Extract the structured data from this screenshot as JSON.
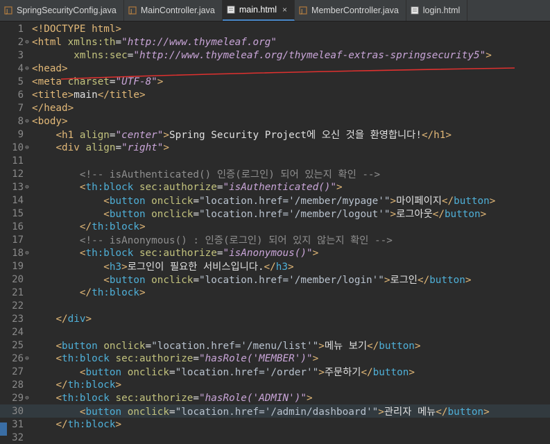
{
  "tabs": [
    {
      "label": "SpringSecurityConfig.java",
      "icon": "java-file-icon",
      "active": false
    },
    {
      "label": "MainController.java",
      "icon": "java-file-icon",
      "active": false
    },
    {
      "label": "main.html",
      "icon": "html-file-icon",
      "active": true,
      "close": "×"
    },
    {
      "label": "MemberController.java",
      "icon": "java-file-icon",
      "active": false
    },
    {
      "label": "login.html",
      "icon": "html-file-icon",
      "active": false
    }
  ],
  "editor": {
    "current_line": 30,
    "annotation_color": "#e0312f",
    "lines": [
      {
        "n": "1",
        "fold": "",
        "segs": [
          [
            "tg",
            "<!DOCTYPE "
          ],
          [
            "tnb",
            "html"
          ],
          [
            "tg",
            ">"
          ]
        ]
      },
      {
        "n": "2",
        "fold": "⊖",
        "segs": [
          [
            "tg",
            "<"
          ],
          [
            "tnb",
            "html "
          ],
          [
            "at",
            "xmlns:th"
          ],
          [
            "tx",
            "="
          ],
          [
            "av",
            "\"http://www.thymeleaf.org\""
          ]
        ]
      },
      {
        "n": "3",
        "fold": "",
        "segs": [
          [
            "tx",
            "       "
          ],
          [
            "at",
            "xmlns:sec"
          ],
          [
            "tx",
            "="
          ],
          [
            "av",
            "\"http://www.thymeleaf.org/thymeleaf-extras-springsecurity5\""
          ],
          [
            "tg",
            ">"
          ]
        ]
      },
      {
        "n": "4",
        "fold": "⊖",
        "segs": [
          [
            "tg",
            "<"
          ],
          [
            "tnb",
            "head"
          ],
          [
            "tg",
            ">"
          ]
        ]
      },
      {
        "n": "5",
        "fold": "",
        "segs": [
          [
            "tg",
            "<"
          ],
          [
            "tnb",
            "meta "
          ],
          [
            "at",
            "charset"
          ],
          [
            "tx",
            "="
          ],
          [
            "av",
            "\"UTF-8\""
          ],
          [
            "tg",
            ">"
          ]
        ]
      },
      {
        "n": "6",
        "fold": "",
        "segs": [
          [
            "tg",
            "<"
          ],
          [
            "tnb",
            "title"
          ],
          [
            "tg",
            ">"
          ],
          [
            "tx",
            "main"
          ],
          [
            "tg",
            "</"
          ],
          [
            "tnb",
            "title"
          ],
          [
            "tg",
            ">"
          ]
        ]
      },
      {
        "n": "7",
        "fold": "",
        "segs": [
          [
            "tg",
            "</"
          ],
          [
            "tnb",
            "head"
          ],
          [
            "tg",
            ">"
          ]
        ]
      },
      {
        "n": "8",
        "fold": "⊖",
        "segs": [
          [
            "tg",
            "<"
          ],
          [
            "tnb",
            "body"
          ],
          [
            "tg",
            ">"
          ]
        ]
      },
      {
        "n": "9",
        "fold": "",
        "segs": [
          [
            "tx",
            "    "
          ],
          [
            "tg",
            "<"
          ],
          [
            "tnb",
            "h1 "
          ],
          [
            "at",
            "align"
          ],
          [
            "tx",
            "="
          ],
          [
            "av",
            "\"center\""
          ],
          [
            "tg",
            ">"
          ],
          [
            "tx",
            "Spring Security Project에 오신 것을 환영합니다!"
          ],
          [
            "tg",
            "</"
          ],
          [
            "tnb",
            "h1"
          ],
          [
            "tg",
            ">"
          ]
        ]
      },
      {
        "n": "10",
        "fold": "⊖",
        "segs": [
          [
            "tx",
            "    "
          ],
          [
            "tg",
            "<"
          ],
          [
            "tnb",
            "div "
          ],
          [
            "at",
            "align"
          ],
          [
            "tx",
            "="
          ],
          [
            "av",
            "\"right\""
          ],
          [
            "tg",
            ">"
          ]
        ]
      },
      {
        "n": "11",
        "fold": "",
        "segs": []
      },
      {
        "n": "12",
        "fold": "",
        "segs": [
          [
            "tx",
            "        "
          ],
          [
            "cm",
            "<!-- isAuthenticated() 인증(로그인) 되어 있는지 확인 -->"
          ]
        ]
      },
      {
        "n": "13",
        "fold": "⊖",
        "segs": [
          [
            "tx",
            "        "
          ],
          [
            "tg",
            "<"
          ],
          [
            "tn",
            "th:block "
          ],
          [
            "at",
            "sec:authorize"
          ],
          [
            "tx",
            "="
          ],
          [
            "av",
            "\"isAuthenticated()\""
          ],
          [
            "tg",
            ">"
          ]
        ]
      },
      {
        "n": "14",
        "fold": "",
        "segs": [
          [
            "tx",
            "            "
          ],
          [
            "tg",
            "<"
          ],
          [
            "tn",
            "button "
          ],
          [
            "at",
            "onclick"
          ],
          [
            "tx",
            "="
          ],
          [
            "avs",
            "\"location.href='/member/mypage'\""
          ],
          [
            "tg",
            ">"
          ],
          [
            "tx",
            "마이페이지"
          ],
          [
            "tg",
            "</"
          ],
          [
            "tn",
            "button"
          ],
          [
            "tg",
            ">"
          ]
        ]
      },
      {
        "n": "15",
        "fold": "",
        "segs": [
          [
            "tx",
            "            "
          ],
          [
            "tg",
            "<"
          ],
          [
            "tn",
            "button "
          ],
          [
            "at",
            "onclick"
          ],
          [
            "tx",
            "="
          ],
          [
            "avs",
            "\"location.href='/member/logout'\""
          ],
          [
            "tg",
            ">"
          ],
          [
            "tx",
            "로그아웃"
          ],
          [
            "tg",
            "</"
          ],
          [
            "tn",
            "button"
          ],
          [
            "tg",
            ">"
          ]
        ]
      },
      {
        "n": "16",
        "fold": "",
        "segs": [
          [
            "tx",
            "        "
          ],
          [
            "tg",
            "</"
          ],
          [
            "tn",
            "th:block"
          ],
          [
            "tg",
            ">"
          ]
        ]
      },
      {
        "n": "17",
        "fold": "",
        "segs": [
          [
            "tx",
            "        "
          ],
          [
            "cm",
            "<!-- isAnonymous() : 인증(로그인) 되어 있지 않는지 확인 -->"
          ]
        ]
      },
      {
        "n": "18",
        "fold": "⊖",
        "segs": [
          [
            "tx",
            "        "
          ],
          [
            "tg",
            "<"
          ],
          [
            "tn",
            "th:block "
          ],
          [
            "at",
            "sec:authorize"
          ],
          [
            "tx",
            "="
          ],
          [
            "av",
            "\"isAnonymous()\""
          ],
          [
            "tg",
            ">"
          ]
        ]
      },
      {
        "n": "19",
        "fold": "",
        "segs": [
          [
            "tx",
            "            "
          ],
          [
            "tg",
            "<"
          ],
          [
            "tn",
            "h3"
          ],
          [
            "tg",
            ">"
          ],
          [
            "tx",
            "로그인이 필요한 서비스입니다."
          ],
          [
            "tg",
            "</"
          ],
          [
            "tn",
            "h3"
          ],
          [
            "tg",
            ">"
          ]
        ]
      },
      {
        "n": "20",
        "fold": "",
        "segs": [
          [
            "tx",
            "            "
          ],
          [
            "tg",
            "<"
          ],
          [
            "tn",
            "button "
          ],
          [
            "at",
            "onclick"
          ],
          [
            "tx",
            "="
          ],
          [
            "avs",
            "\"location.href='/member/login'\""
          ],
          [
            "tg",
            ">"
          ],
          [
            "tx",
            "로그인"
          ],
          [
            "tg",
            "</"
          ],
          [
            "tn",
            "button"
          ],
          [
            "tg",
            ">"
          ]
        ]
      },
      {
        "n": "21",
        "fold": "",
        "segs": [
          [
            "tx",
            "        "
          ],
          [
            "tg",
            "</"
          ],
          [
            "tn",
            "th:block"
          ],
          [
            "tg",
            ">"
          ]
        ]
      },
      {
        "n": "22",
        "fold": "",
        "segs": []
      },
      {
        "n": "23",
        "fold": "",
        "segs": [
          [
            "tx",
            "    "
          ],
          [
            "tg",
            "</"
          ],
          [
            "tn",
            "div"
          ],
          [
            "tg",
            ">"
          ]
        ]
      },
      {
        "n": "24",
        "fold": "",
        "segs": []
      },
      {
        "n": "25",
        "fold": "",
        "segs": [
          [
            "tx",
            "    "
          ],
          [
            "tg",
            "<"
          ],
          [
            "tn",
            "button "
          ],
          [
            "at",
            "onclick"
          ],
          [
            "tx",
            "="
          ],
          [
            "avs",
            "\"location.href='/menu/list'\""
          ],
          [
            "tg",
            ">"
          ],
          [
            "tx",
            "메뉴 보기"
          ],
          [
            "tg",
            "</"
          ],
          [
            "tn",
            "button"
          ],
          [
            "tg",
            ">"
          ]
        ]
      },
      {
        "n": "26",
        "fold": "⊖",
        "segs": [
          [
            "tx",
            "    "
          ],
          [
            "tg",
            "<"
          ],
          [
            "tn",
            "th:block "
          ],
          [
            "at",
            "sec:authorize"
          ],
          [
            "tx",
            "="
          ],
          [
            "av",
            "\"hasRole('MEMBER')\""
          ],
          [
            "tg",
            ">"
          ]
        ]
      },
      {
        "n": "27",
        "fold": "",
        "segs": [
          [
            "tx",
            "        "
          ],
          [
            "tg",
            "<"
          ],
          [
            "tn",
            "button "
          ],
          [
            "at",
            "onclick"
          ],
          [
            "tx",
            "="
          ],
          [
            "avs",
            "\"location.href='/order'\""
          ],
          [
            "tg",
            ">"
          ],
          [
            "tx",
            "주문하기"
          ],
          [
            "tg",
            "</"
          ],
          [
            "tn",
            "button"
          ],
          [
            "tg",
            ">"
          ]
        ]
      },
      {
        "n": "28",
        "fold": "",
        "segs": [
          [
            "tx",
            "    "
          ],
          [
            "tg",
            "</"
          ],
          [
            "tn",
            "th:block"
          ],
          [
            "tg",
            ">"
          ]
        ]
      },
      {
        "n": "29",
        "fold": "⊖",
        "segs": [
          [
            "tx",
            "    "
          ],
          [
            "tg",
            "<"
          ],
          [
            "tn",
            "th:block "
          ],
          [
            "at",
            "sec:authorize"
          ],
          [
            "tx",
            "="
          ],
          [
            "av",
            "\"hasRole('ADMIN')\""
          ],
          [
            "tg",
            ">"
          ]
        ]
      },
      {
        "n": "30",
        "fold": "",
        "segs": [
          [
            "tx",
            "        "
          ],
          [
            "tg",
            "<"
          ],
          [
            "tn",
            "button "
          ],
          [
            "at",
            "onclick"
          ],
          [
            "tx",
            "="
          ],
          [
            "avs",
            "\"location.href='/admin/dashboard'\""
          ],
          [
            "tg",
            ">"
          ],
          [
            "tx",
            "관리자 메뉴"
          ],
          [
            "tg",
            "</"
          ],
          [
            "tn",
            "button"
          ],
          [
            "tg",
            ">"
          ]
        ]
      },
      {
        "n": "31",
        "fold": "",
        "segs": [
          [
            "tx",
            "    "
          ],
          [
            "tg",
            "</"
          ],
          [
            "tn",
            "th:block"
          ],
          [
            "tg",
            ">"
          ]
        ]
      },
      {
        "n": "32",
        "fold": "",
        "segs": []
      }
    ]
  }
}
